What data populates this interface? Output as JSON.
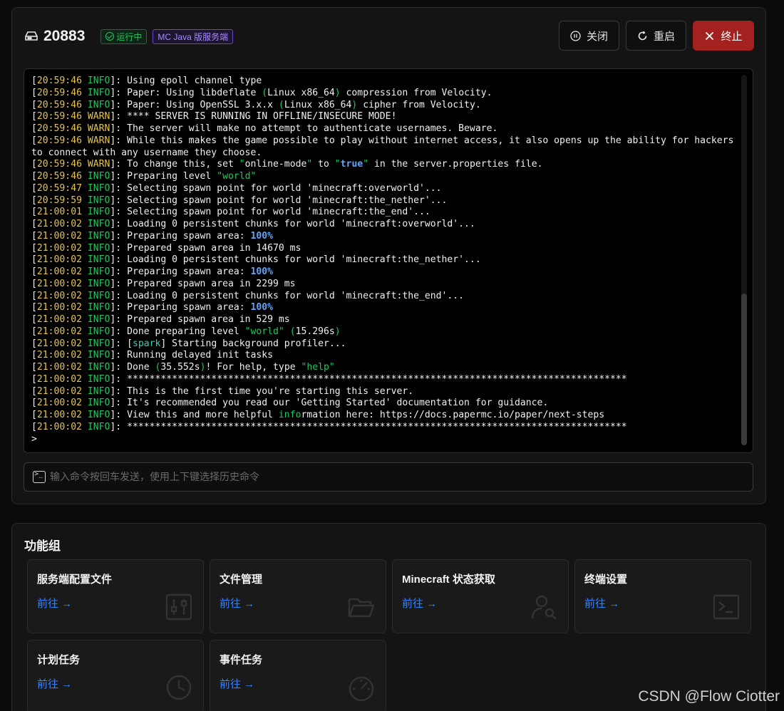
{
  "header": {
    "server_id": "20883",
    "status_badge": "运行中",
    "type_badge": "MC Java 版服务端",
    "close_label": "关闭",
    "restart_label": "重启",
    "stop_label": "终止"
  },
  "console": {
    "lines": [
      {
        "ts": "20:59:46",
        "level": "INFO",
        "msg": [
          {
            "t": "Using epoll channel type"
          }
        ]
      },
      {
        "ts": "20:59:46",
        "level": "INFO",
        "msg": [
          {
            "t": "Paper: Using libdeflate "
          },
          {
            "t": "(",
            "c": "g"
          },
          {
            "t": "Linux x86_64"
          },
          {
            "t": ")",
            "c": "g"
          },
          {
            "t": " compression from Velocity."
          }
        ]
      },
      {
        "ts": "20:59:46",
        "level": "INFO",
        "msg": [
          {
            "t": "Paper: Using OpenSSL 3.x.x "
          },
          {
            "t": "(",
            "c": "g"
          },
          {
            "t": "Linux x86_64"
          },
          {
            "t": ")",
            "c": "g"
          },
          {
            "t": " cipher from Velocity."
          }
        ]
      },
      {
        "ts": "20:59:46",
        "level": "WARN",
        "msg": [
          {
            "t": "**** SERVER IS RUNNING IN OFFLINE/INSECURE MODE!"
          }
        ]
      },
      {
        "ts": "20:59:46",
        "level": "WARN",
        "msg": [
          {
            "t": "The server will make no attempt to authenticate usernames. Beware."
          }
        ]
      },
      {
        "ts": "20:59:46",
        "level": "WARN",
        "msg": [
          {
            "t": "While this makes the game possible to play without internet access, it also opens up the ability for hackers to connect with any username they choose."
          }
        ]
      },
      {
        "ts": "20:59:46",
        "level": "WARN",
        "msg": [
          {
            "t": "To change this, set "
          },
          {
            "t": "\"",
            "c": "g"
          },
          {
            "t": "online-mode"
          },
          {
            "t": "\"",
            "c": "g"
          },
          {
            "t": " to "
          },
          {
            "t": "\"",
            "c": "g"
          },
          {
            "t": "true",
            "c": "b"
          },
          {
            "t": "\"",
            "c": "g"
          },
          {
            "t": " in the server.properties file."
          }
        ]
      },
      {
        "ts": "20:59:46",
        "level": "INFO",
        "msg": [
          {
            "t": "Preparing level "
          },
          {
            "t": "\"world\"",
            "c": "g"
          }
        ]
      },
      {
        "ts": "20:59:47",
        "level": "INFO",
        "msg": [
          {
            "t": "Selecting spawn point for world 'minecraft:overworld'..."
          }
        ]
      },
      {
        "ts": "20:59:59",
        "level": "INFO",
        "msg": [
          {
            "t": "Selecting spawn point for world 'minecraft:the_nether'..."
          }
        ]
      },
      {
        "ts": "21:00:01",
        "level": "INFO",
        "msg": [
          {
            "t": "Selecting spawn point for world 'minecraft:the_end'..."
          }
        ]
      },
      {
        "ts": "21:00:02",
        "level": "INFO",
        "msg": [
          {
            "t": "Loading 0 persistent chunks for world 'minecraft:overworld'..."
          }
        ]
      },
      {
        "ts": "21:00:02",
        "level": "INFO",
        "msg": [
          {
            "t": "Preparing spawn area: "
          },
          {
            "t": "100%",
            "c": "b"
          }
        ]
      },
      {
        "ts": "21:00:02",
        "level": "INFO",
        "msg": [
          {
            "t": "Prepared spawn area in 14670 ms"
          }
        ]
      },
      {
        "ts": "21:00:02",
        "level": "INFO",
        "msg": [
          {
            "t": "Loading 0 persistent chunks for world 'minecraft:the_nether'..."
          }
        ]
      },
      {
        "ts": "21:00:02",
        "level": "INFO",
        "msg": [
          {
            "t": "Preparing spawn area: "
          },
          {
            "t": "100%",
            "c": "b"
          }
        ]
      },
      {
        "ts": "21:00:02",
        "level": "INFO",
        "msg": [
          {
            "t": "Prepared spawn area in 2299 ms"
          }
        ]
      },
      {
        "ts": "21:00:02",
        "level": "INFO",
        "msg": [
          {
            "t": "Loading 0 persistent chunks for world 'minecraft:the_end'..."
          }
        ]
      },
      {
        "ts": "21:00:02",
        "level": "INFO",
        "msg": [
          {
            "t": "Preparing spawn area: "
          },
          {
            "t": "100%",
            "c": "b"
          }
        ]
      },
      {
        "ts": "21:00:02",
        "level": "INFO",
        "msg": [
          {
            "t": "Prepared spawn area in 529 ms"
          }
        ]
      },
      {
        "ts": "21:00:02",
        "level": "INFO",
        "msg": [
          {
            "t": "Done preparing level "
          },
          {
            "t": "\"world\"",
            "c": "g"
          },
          {
            "t": " "
          },
          {
            "t": "(",
            "c": "g"
          },
          {
            "t": "15.296s"
          },
          {
            "t": ")",
            "c": "g"
          }
        ]
      },
      {
        "ts": "21:00:02",
        "level": "INFO",
        "msg": [
          {
            "t": "["
          },
          {
            "t": "spark",
            "c": "c"
          },
          {
            "t": "] Starting background profiler..."
          }
        ]
      },
      {
        "ts": "21:00:02",
        "level": "INFO",
        "msg": [
          {
            "t": "Running delayed init tasks"
          }
        ]
      },
      {
        "ts": "21:00:02",
        "level": "INFO",
        "msg": [
          {
            "t": "Done "
          },
          {
            "t": "(",
            "c": "g"
          },
          {
            "t": "35.552s"
          },
          {
            "t": ")",
            "c": "g"
          },
          {
            "t": "! For help, type "
          },
          {
            "t": "\"help\"",
            "c": "g"
          }
        ]
      },
      {
        "ts": "21:00:02",
        "level": "INFO",
        "msg": [
          {
            "t": "*****************************************************************************************"
          }
        ]
      },
      {
        "ts": "21:00:02",
        "level": "INFO",
        "msg": [
          {
            "t": "This is the first time you're starting this server."
          }
        ]
      },
      {
        "ts": "21:00:02",
        "level": "INFO",
        "msg": [
          {
            "t": "It's recommended you read our 'Getting Started' documentation for guidance."
          }
        ]
      },
      {
        "ts": "21:00:02",
        "level": "INFO",
        "msg": [
          {
            "t": "View this and more helpful "
          },
          {
            "t": "info",
            "c": "g"
          },
          {
            "t": "rmation here: https://docs.papermc.io/paper/next-steps"
          }
        ]
      },
      {
        "ts": "21:00:02",
        "level": "INFO",
        "msg": [
          {
            "t": "*****************************************************************************************"
          }
        ]
      }
    ],
    "prompt": ">",
    "input_placeholder": "输入命令按回车发送，使用上下键选择历史命令"
  },
  "functions": {
    "title": "功能组",
    "cards": [
      {
        "title": "服务端配置文件",
        "link": "前往 →",
        "icon": "sliders-icon"
      },
      {
        "title": "文件管理",
        "link": "前往 →",
        "icon": "folder-icon"
      },
      {
        "title": "Minecraft 状态获取",
        "link": "前往 →",
        "icon": "user-search-icon"
      },
      {
        "title": "终端设置",
        "link": "前往 →",
        "icon": "terminal-icon"
      },
      {
        "title": "计划任务",
        "link": "前往 →",
        "icon": "clock-icon"
      },
      {
        "title": "事件任务",
        "link": "前往 →",
        "icon": "gauge-icon"
      }
    ]
  },
  "watermark": "CSDN @Flow Ciotter",
  "colors": {
    "accent_blue": "#3b82f6",
    "running_green": "#22c55e",
    "warn_yellow": "#e8c547",
    "stop_red": "#a3211f",
    "type_purple": "#a78bfa"
  }
}
